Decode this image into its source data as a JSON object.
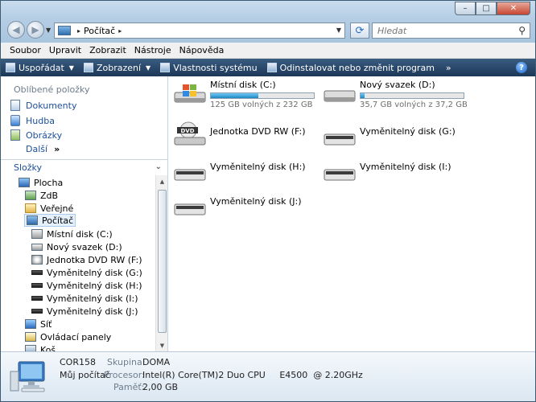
{
  "window": {
    "minimize_glyph": "–",
    "maximize_glyph": "□",
    "close_glyph": "✕"
  },
  "address": {
    "location": "Počítač",
    "separator": "▸"
  },
  "search": {
    "placeholder": "Hledat"
  },
  "menu": [
    "Soubor",
    "Upravit",
    "Zobrazit",
    "Nástroje",
    "Nápověda"
  ],
  "toolbar": {
    "organize": "Uspořádat",
    "views": "Zobrazení",
    "system_properties": "Vlastnosti systému",
    "uninstall": "Odinstalovat nebo změnit program",
    "more": "»"
  },
  "favorites": {
    "title": "Oblíbené položky",
    "items": [
      "Dokumenty",
      "Hudba",
      "Obrázky"
    ],
    "more": "Další",
    "more_arrow": "»"
  },
  "folders": {
    "title": "Složky",
    "tree": [
      {
        "label": "Plocha",
        "icon": "desktop-icon"
      },
      {
        "label": "ZdB",
        "icon": "user-folder-icon"
      },
      {
        "label": "Veřejné",
        "icon": "folder-icon"
      },
      {
        "label": "Počítač",
        "icon": "computer-icon"
      },
      {
        "label": "Místní disk (C:)",
        "icon": "windows-drive-icon"
      },
      {
        "label": "Nový svazek (D:)",
        "icon": "hard-drive-icon"
      },
      {
        "label": "Jednotka DVD RW (F:)",
        "icon": "dvd-drive-icon"
      },
      {
        "label": "Vyměnitelný disk (G:)",
        "icon": "removable-drive-icon"
      },
      {
        "label": "Vyměnitelný disk (H:)",
        "icon": "removable-drive-icon"
      },
      {
        "label": "Vyměnitelný disk (I:)",
        "icon": "removable-drive-icon"
      },
      {
        "label": "Vyměnitelný disk (J:)",
        "icon": "removable-drive-icon"
      },
      {
        "label": "Síť",
        "icon": "network-icon"
      },
      {
        "label": "Ovládací panely",
        "icon": "control-panel-icon"
      },
      {
        "label": "Koš",
        "icon": "recycle-bin-icon"
      }
    ]
  },
  "drives": [
    {
      "name": "Místní disk (C:)",
      "info": "125 GB volných z 232 GB",
      "used_fraction": 0.46,
      "icon": "windows-drive-icon"
    },
    {
      "name": "Nový svazek (D:)",
      "info": "35,7 GB volných z 37,2 GB",
      "used_fraction": 0.04,
      "icon": "hard-drive-icon"
    },
    {
      "name": "Jednotka DVD RW (F:)",
      "icon": "dvd-drive-icon"
    },
    {
      "name": "Vyměnitelný disk (G:)",
      "icon": "removable-drive-icon"
    },
    {
      "name": "Vyměnitelný disk (H:)",
      "icon": "removable-drive-icon"
    },
    {
      "name": "Vyměnitelný disk (I:)",
      "icon": "removable-drive-icon"
    },
    {
      "name": "Vyměnitelný disk (J:)",
      "icon": "removable-drive-icon"
    }
  ],
  "details": {
    "computer_name": "COR158",
    "subtitle": "Můj počítač",
    "workgroup_label": "Skupina:",
    "workgroup": "DOMA",
    "processor_label": "Procesor:",
    "processor": "Intel(R) Core(TM)2 Duo CPU     E4500  @ 2.20GHz",
    "memory_label": "Paměť:",
    "memory": "2,00 GB"
  },
  "colors": {
    "accent": "#1986c4",
    "link": "#1c4f9a",
    "toolbar": "#29476a"
  }
}
